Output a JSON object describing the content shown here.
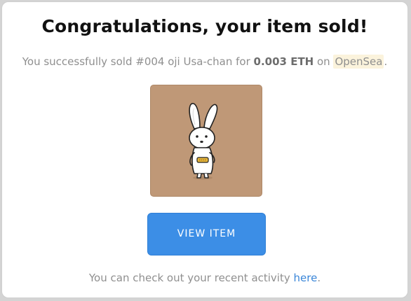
{
  "title": "Congratulations, your item sold!",
  "sale": {
    "prefix": "You successfully sold ",
    "item_name": "#004 oji Usa-chan",
    "for_text": " for ",
    "price": "0.003 ETH",
    "on_text": " on ",
    "marketplace": "OpenSea",
    "suffix": "."
  },
  "nft_image": {
    "subject": "rabbit-character",
    "background_color": "#bf9877"
  },
  "button": {
    "label": "VIEW ITEM"
  },
  "footer": {
    "text": "You can check out your recent activity ",
    "link_label": "here",
    "suffix": "."
  },
  "colors": {
    "button_blue": "#3c8ee6",
    "link_blue": "#3a86d8",
    "highlight": "#fbf3dc"
  }
}
